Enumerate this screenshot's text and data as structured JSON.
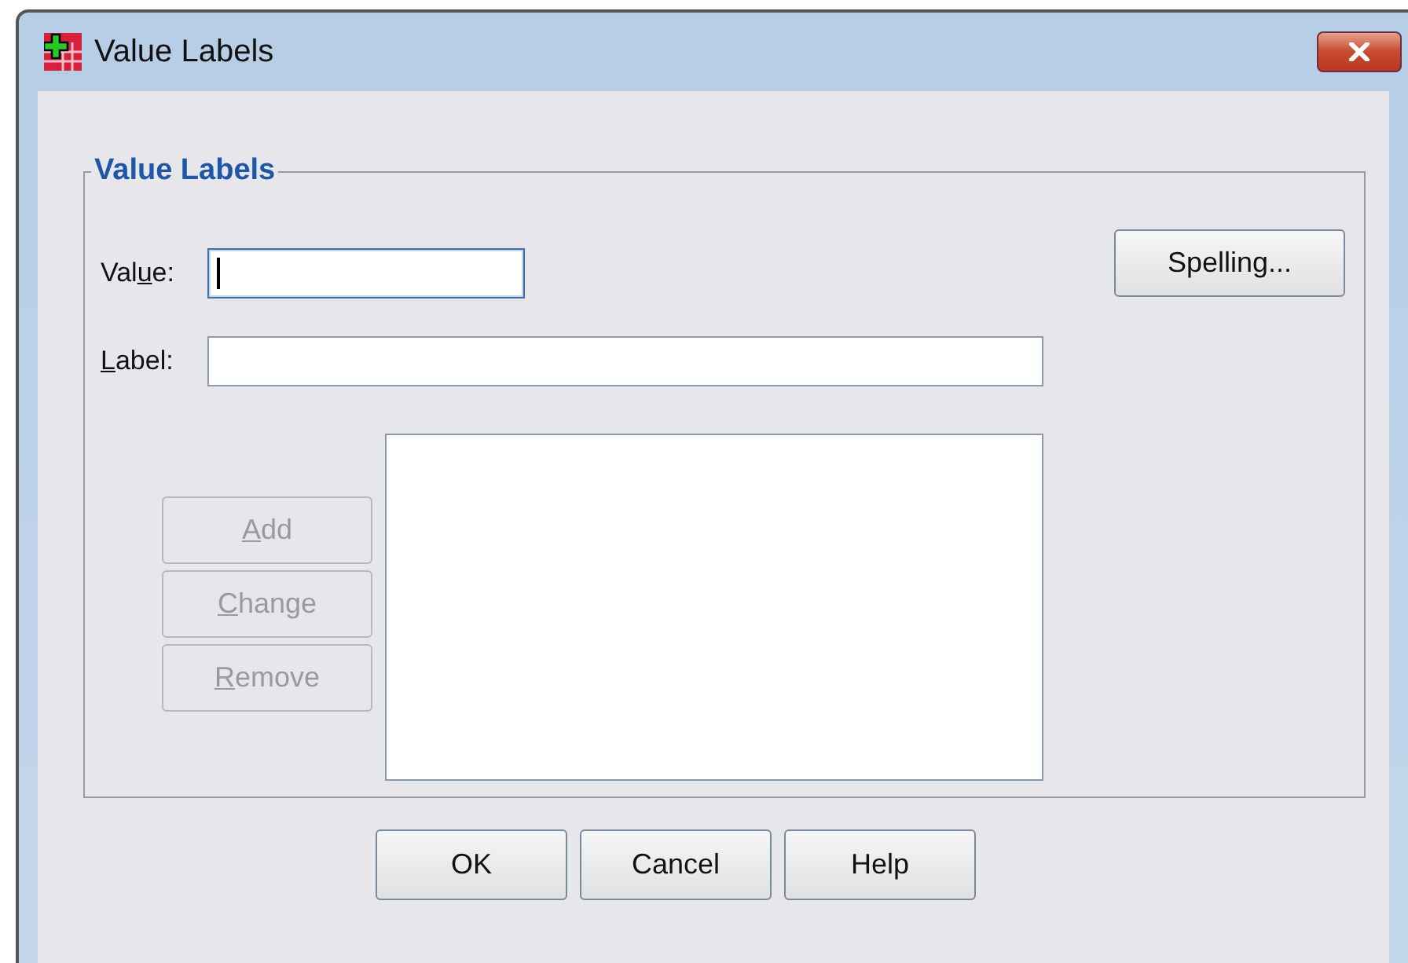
{
  "window": {
    "title": "Value Labels"
  },
  "group": {
    "title": "Value Labels"
  },
  "fields": [
    {
      "label": {
        "before": "Val",
        "key": "u",
        "after": "e:"
      },
      "focused": true,
      "kind": "short"
    },
    {
      "label": {
        "key": "L",
        "after": "abel:"
      },
      "focused": false,
      "kind": "long"
    }
  ],
  "spelling_button": "Spelling...",
  "list_buttons": [
    {
      "label": {
        "key": "A",
        "after": "dd"
      },
      "disabled": true
    },
    {
      "label": {
        "key": "C",
        "after": "hange"
      },
      "disabled": true
    },
    {
      "label": {
        "key": "R",
        "after": "emove"
      },
      "disabled": true
    }
  ],
  "buttons": [
    "OK",
    "Cancel",
    "Help"
  ]
}
